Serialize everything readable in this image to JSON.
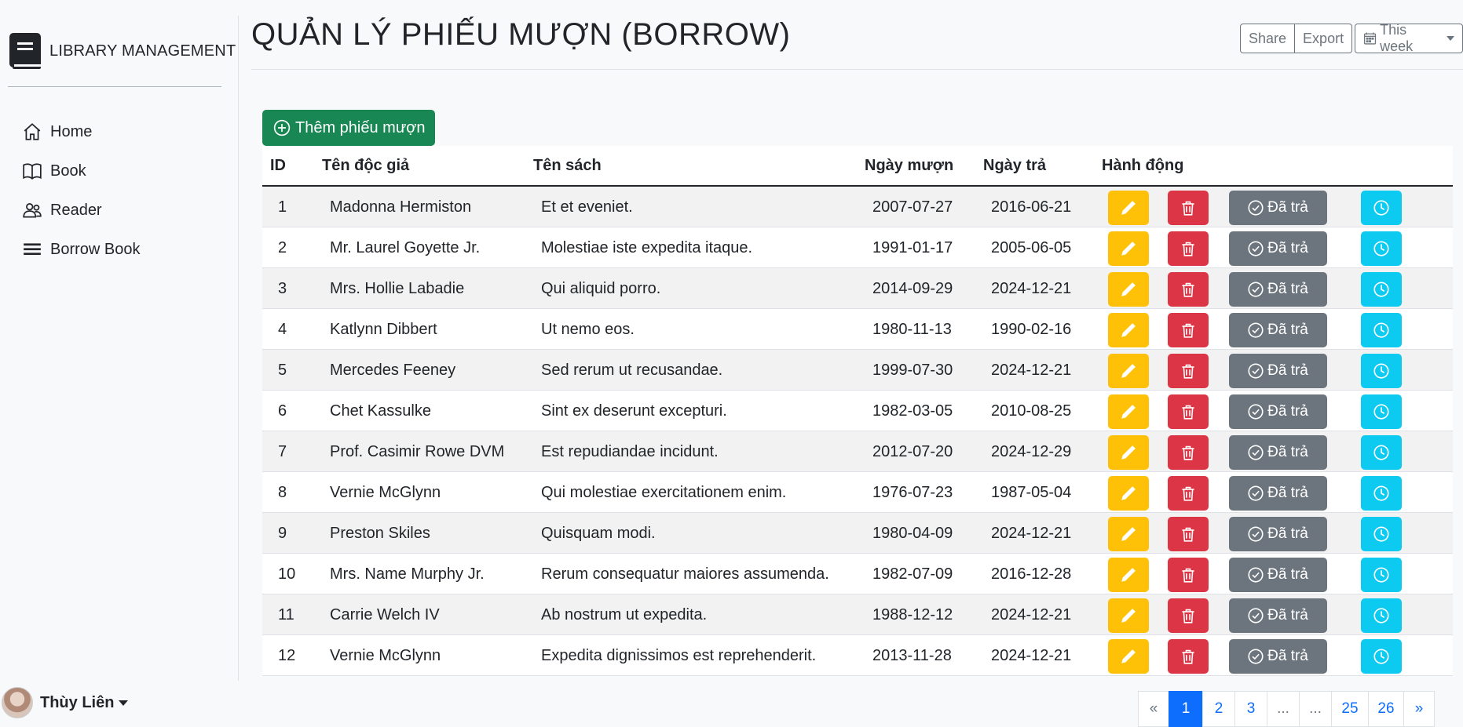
{
  "sidebar": {
    "brand": "LIBRARY MANAGEMENT",
    "items": [
      {
        "label": "Home",
        "icon": "home-icon"
      },
      {
        "label": "Book",
        "icon": "book-icon"
      },
      {
        "label": "Reader",
        "icon": "people-icon"
      },
      {
        "label": "Borrow Book",
        "icon": "list-icon"
      }
    ],
    "user": "Thùy Liên"
  },
  "header": {
    "title": "QUẢN LÝ PHIẾU MƯỢN (BORROW)",
    "share_label": "Share",
    "export_label": "Export",
    "week_label": "This week"
  },
  "add_button_label": "Thêm phiếu mượn",
  "table": {
    "headers": [
      "ID",
      "Tên độc giả",
      "Tên sách",
      "Ngày mượn",
      "Ngày trả",
      "Hành động"
    ],
    "return_label": "Đã trả",
    "rows": [
      {
        "id": "1",
        "reader": "Madonna Hermiston",
        "book": "Et et eveniet.",
        "borrow": "2007-07-27",
        "due": "2016-06-21"
      },
      {
        "id": "2",
        "reader": "Mr. Laurel Goyette Jr.",
        "book": "Molestiae iste expedita itaque.",
        "borrow": "1991-01-17",
        "due": "2005-06-05"
      },
      {
        "id": "3",
        "reader": "Mrs. Hollie Labadie",
        "book": "Qui aliquid porro.",
        "borrow": "2014-09-29",
        "due": "2024-12-21"
      },
      {
        "id": "4",
        "reader": "Katlynn Dibbert",
        "book": "Ut nemo eos.",
        "borrow": "1980-11-13",
        "due": "1990-02-16"
      },
      {
        "id": "5",
        "reader": "Mercedes Feeney",
        "book": "Sed rerum ut recusandae.",
        "borrow": "1999-07-30",
        "due": "2024-12-21"
      },
      {
        "id": "6",
        "reader": "Chet Kassulke",
        "book": "Sint ex deserunt excepturi.",
        "borrow": "1982-03-05",
        "due": "2010-08-25"
      },
      {
        "id": "7",
        "reader": "Prof. Casimir Rowe DVM",
        "book": "Est repudiandae incidunt.",
        "borrow": "2012-07-20",
        "due": "2024-12-29"
      },
      {
        "id": "8",
        "reader": "Vernie McGlynn",
        "book": "Qui molestiae exercitationem enim.",
        "borrow": "1976-07-23",
        "due": "1987-05-04"
      },
      {
        "id": "9",
        "reader": "Preston Skiles",
        "book": "Quisquam modi.",
        "borrow": "1980-04-09",
        "due": "2024-12-21"
      },
      {
        "id": "10",
        "reader": "Mrs. Name Murphy Jr.",
        "book": "Rerum consequatur maiores assumenda.",
        "borrow": "1982-07-09",
        "due": "2016-12-28"
      },
      {
        "id": "11",
        "reader": "Carrie Welch IV",
        "book": "Ab nostrum ut expedita.",
        "borrow": "1988-12-12",
        "due": "2024-12-21"
      },
      {
        "id": "12",
        "reader": "Vernie McGlynn",
        "book": "Expedita dignissimos est reprehenderit.",
        "borrow": "2013-11-28",
        "due": "2024-12-21"
      }
    ]
  },
  "pagination": {
    "pages": [
      {
        "label": "«",
        "state": "disabled"
      },
      {
        "label": "1",
        "state": "active"
      },
      {
        "label": "2",
        "state": ""
      },
      {
        "label": "3",
        "state": ""
      },
      {
        "label": "...",
        "state": "disabled"
      },
      {
        "label": "...",
        "state": "disabled"
      },
      {
        "label": "25",
        "state": ""
      },
      {
        "label": "26",
        "state": ""
      },
      {
        "label": "»",
        "state": ""
      }
    ]
  },
  "colors": {
    "success": "#198754",
    "warning": "#ffc107",
    "danger": "#dc3545",
    "secondary": "#6c757d",
    "info": "#0dcaf0",
    "primary": "#0d6efd"
  }
}
